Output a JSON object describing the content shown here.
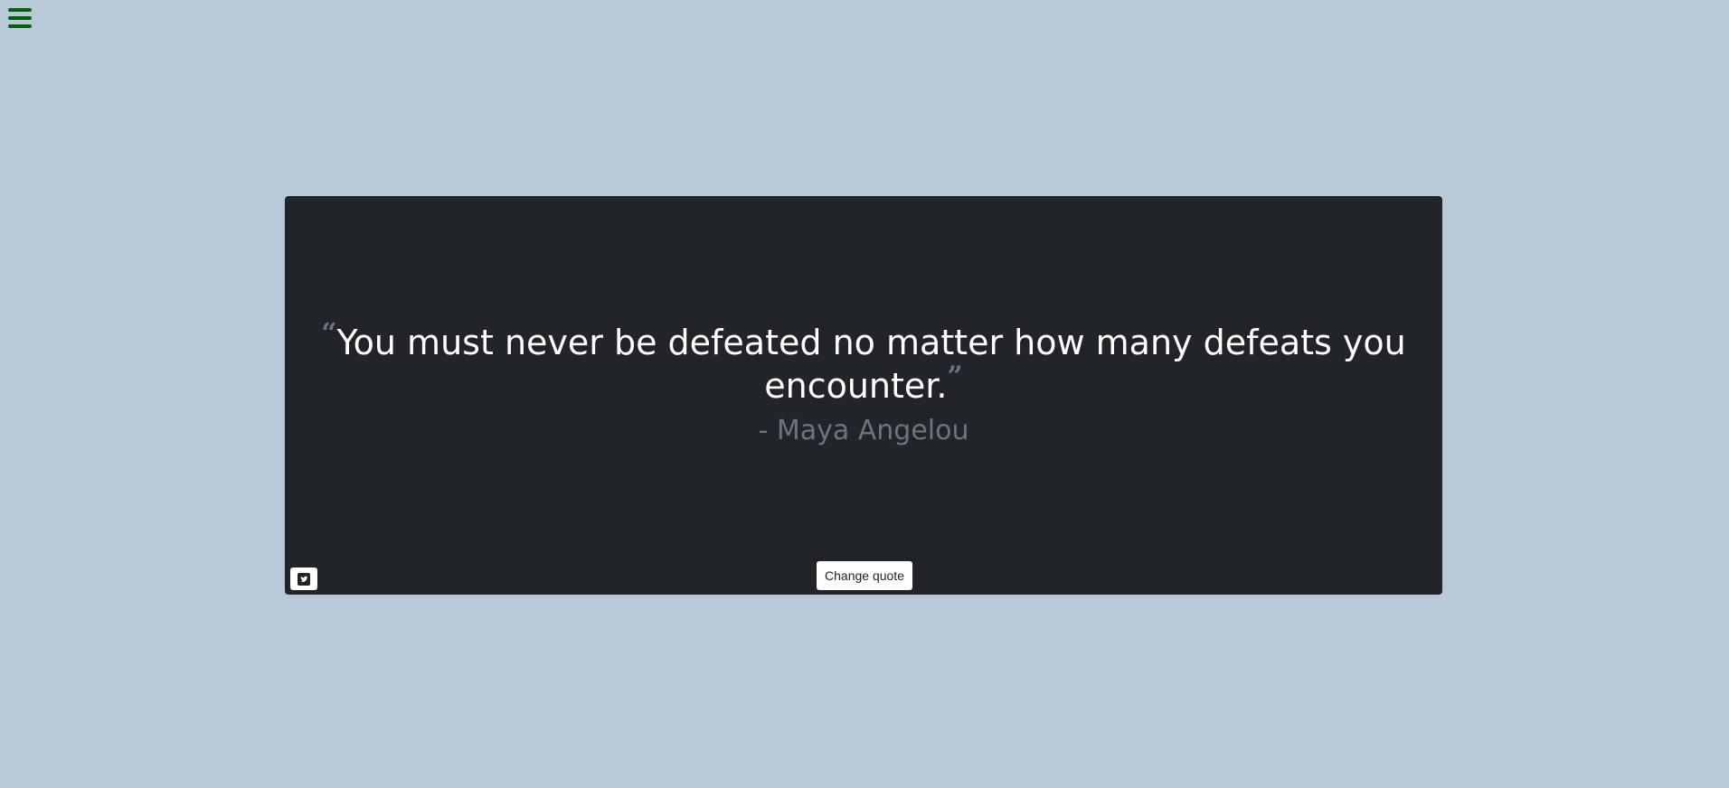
{
  "nav": {
    "menu_icon": "hamburger-menu-icon",
    "menu_color": "#0b5d0b"
  },
  "quote": {
    "open_mark": "“",
    "text": "You must never be defeated no matter how many defeats you encounter.",
    "close_mark": "”",
    "author": "- Maya Angelou"
  },
  "actions": {
    "tweet_icon": "twitter-icon",
    "change_quote_label": "Change quote"
  },
  "colors": {
    "background": "#b8cad8",
    "card": "#212529",
    "quote_text": "#ffffff",
    "muted": "#6c757d"
  }
}
